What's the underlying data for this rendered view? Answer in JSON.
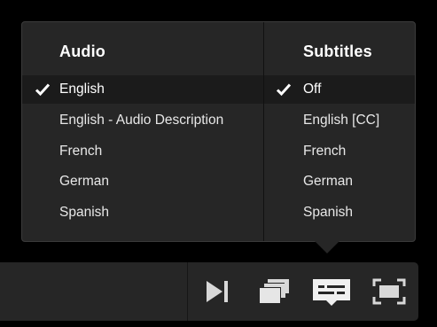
{
  "audio": {
    "title": "Audio",
    "options": [
      {
        "label": "English",
        "selected": true
      },
      {
        "label": "English - Audio Description",
        "selected": false
      },
      {
        "label": "French",
        "selected": false
      },
      {
        "label": "German",
        "selected": false
      },
      {
        "label": "Spanish",
        "selected": false
      }
    ]
  },
  "subtitles": {
    "title": "Subtitles",
    "options": [
      {
        "label": "Off",
        "selected": true
      },
      {
        "label": "English [CC]",
        "selected": false
      },
      {
        "label": "French",
        "selected": false
      },
      {
        "label": "German",
        "selected": false
      },
      {
        "label": "Spanish",
        "selected": false
      }
    ]
  },
  "controls": {
    "icons": [
      "next-episode-icon",
      "episodes-icon",
      "subtitles-icon",
      "fullscreen-icon"
    ]
  },
  "colors": {
    "panel": "#262626",
    "selected_row": "#1b1b1b",
    "text": "#e8e8e8",
    "background": "#000000"
  }
}
